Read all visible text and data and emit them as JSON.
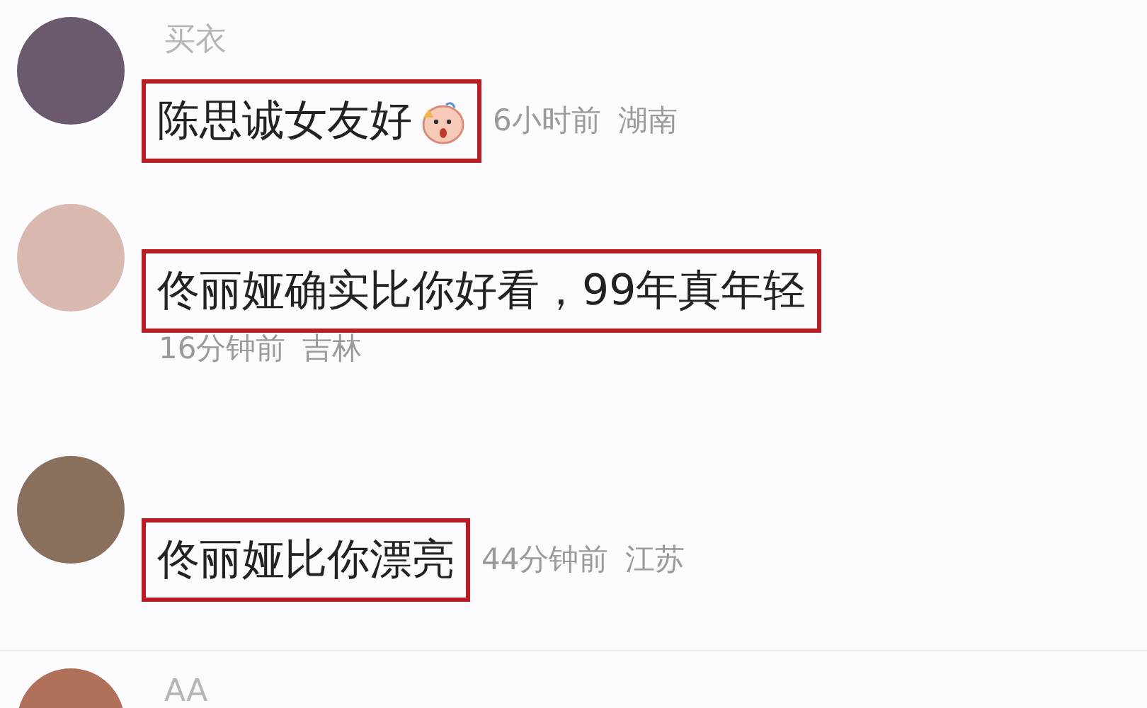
{
  "comments": [
    {
      "kind": "inline",
      "username": "买衣",
      "text": "陈思诚女友好",
      "emoji": true,
      "time": "6小时前",
      "location": "湖南",
      "highlighted": true
    },
    {
      "kind": "below",
      "text": "佟丽娅确实比你好看，99年真年轻",
      "emoji": false,
      "time": "16分钟前",
      "location": "吉林",
      "highlighted": true
    },
    {
      "kind": "inline",
      "text": "佟丽娅比你漂亮",
      "emoji": false,
      "time": "44分钟前",
      "location": "江苏",
      "highlighted": true
    },
    {
      "kind": "cut",
      "username": "AA"
    }
  ]
}
